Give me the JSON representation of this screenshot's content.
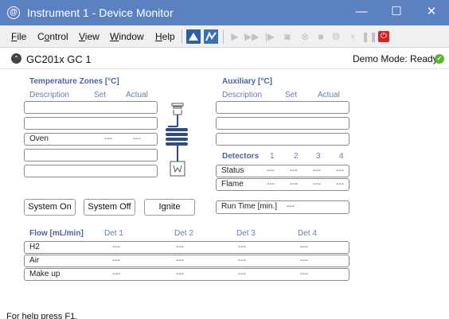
{
  "window": {
    "app_icon_glyph": "@",
    "title": "Instrument 1 - Device Monitor",
    "minimize_glyph": "—",
    "maximize_glyph": "☐",
    "close_glyph": "✕"
  },
  "menu": {
    "file": "File",
    "control": "Control",
    "view": "View",
    "window": "Window",
    "help": "Help"
  },
  "toolbar": {
    "icons": [
      "method-icon",
      "sequence-icon",
      "run-icon",
      "run-all-icon",
      "step-icon",
      "snapshot-icon",
      "abort-icon",
      "stop-icon",
      "tools-icon",
      "lamp-icon",
      "pause-icon",
      "power-off-icon"
    ],
    "power_glyph": "⏻"
  },
  "device": {
    "collapse_glyph": "⌃",
    "name": "GC201x  GC 1",
    "status": "Demo Mode: Ready",
    "status_color": "#5ab531"
  },
  "temperature": {
    "title": "Temperature Zones [°C]",
    "col_description": "Description",
    "col_set": "Set",
    "col_actual": "Actual",
    "rows": [
      {
        "description": "",
        "set": "",
        "actual": ""
      },
      {
        "description": "",
        "set": "",
        "actual": ""
      },
      {
        "description": "Oven",
        "set": "---",
        "actual": "---"
      },
      {
        "description": "",
        "set": "",
        "actual": ""
      },
      {
        "description": "",
        "set": "",
        "actual": ""
      }
    ]
  },
  "auxiliary": {
    "title": "Auxiliary [°C]",
    "col_description": "Description",
    "col_set": "Set",
    "col_actual": "Actual"
  },
  "detectors": {
    "title": "Detectors",
    "columns": [
      "1",
      "2",
      "3",
      "4"
    ],
    "rows": [
      {
        "label": "Status",
        "values": [
          "---",
          "---",
          "---",
          "---"
        ]
      },
      {
        "label": "Flame",
        "values": [
          "---",
          "---",
          "---",
          "---"
        ]
      }
    ]
  },
  "buttons": {
    "system_on": "System On",
    "system_off": "System Off",
    "ignite": "Ignite"
  },
  "run_time": {
    "label": "Run Time [min.]",
    "value": "---"
  },
  "flow": {
    "title": "Flow [mL/min]",
    "columns": [
      "Det 1",
      "Det 2",
      "Det 3",
      "Det 4"
    ],
    "rows": [
      {
        "label": "H2",
        "values": [
          "---",
          "---",
          "---",
          "---"
        ]
      },
      {
        "label": "Air",
        "values": [
          "---",
          "---",
          "---",
          "---"
        ]
      },
      {
        "label": "Make up",
        "values": [
          "---",
          "---",
          "---",
          "---"
        ]
      }
    ]
  },
  "statusbar": {
    "text": "For help press F1."
  },
  "colors": {
    "titlebar": "#5b81c1",
    "section_title": "#4b64a6",
    "column_header": "#6a7cb0",
    "oven_coil": "#2c4a8c"
  }
}
